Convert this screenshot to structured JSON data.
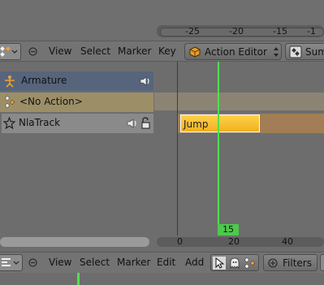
{
  "timeline_top": {
    "ticks": [
      "-25",
      "-20",
      "-15",
      "-1"
    ]
  },
  "nla_header": {
    "menus": [
      "View",
      "Select",
      "Marker",
      "Key"
    ],
    "editor_type": "Action Editor",
    "mode_label": "Summ"
  },
  "channels": {
    "armature": "Armature",
    "action": "<No Action>",
    "track": "NlaTrack"
  },
  "strip": {
    "name": "Jump"
  },
  "playhead": {
    "frame": "15"
  },
  "timeline_bottom": {
    "ticks": [
      "0",
      "20",
      "40"
    ]
  },
  "bottom_header": {
    "menus": [
      "View",
      "Select",
      "Marker",
      "Edit",
      "Add"
    ],
    "filters_label": "Filters"
  },
  "colors": {
    "playhead": "#4fe04f",
    "strip": "#f0b020",
    "armature_row": "#56657c",
    "action_row": "#9c8f68"
  }
}
